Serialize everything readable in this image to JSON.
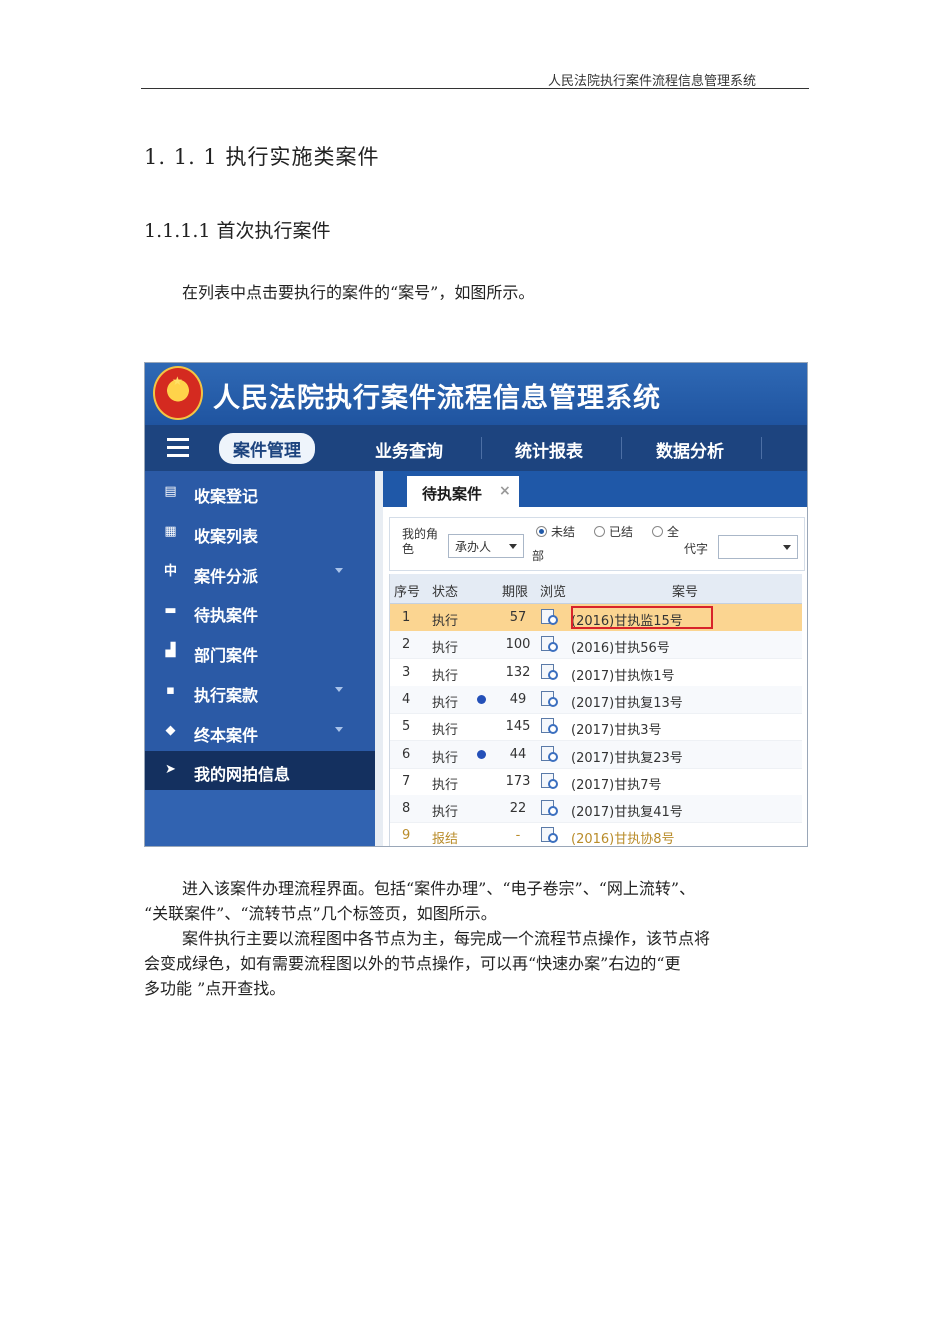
{
  "running_header": "人民法院执行案件流程信息管理系统",
  "heading_1": "1. 1. 1  执行实施类案件",
  "heading_2": "1.1.1.1 首次执行案件",
  "intro": "在列表中点击要执行的案件的“案号”，如图所示。",
  "body_lines": [
    "进入该案件办理流程界面。包括“案件办理”、“电子卷宗”、“网上流转”、",
    "“关联案件”、“流转节点”几个标签页，如图所示。",
    "案件执行主要以流程图中各节点为主，每完成一个流程节点操作，该节点将",
    "会变成绿色，如有需要流程图以外的节点操作，可以再“快速办案”右边的“更",
    "多功能  ”点开查找。"
  ],
  "app": {
    "title": "人民法院执行案件流程信息管理系统",
    "nav": [
      "案件管理",
      "业务查询",
      "统计报表",
      "数据分析"
    ],
    "sidebar": [
      {
        "label": "收案登记",
        "icon": "register-icon",
        "glyph": "▤",
        "arrow": false
      },
      {
        "label": "收案列表",
        "icon": "list-icon",
        "glyph": "▦",
        "arrow": false
      },
      {
        "label": "案件分派",
        "icon": "distribute-icon",
        "glyph": "中",
        "arrow": true
      },
      {
        "label": "待执案件",
        "icon": "briefcase-icon",
        "glyph": "▬",
        "arrow": false
      },
      {
        "label": "部门案件",
        "icon": "department-icon",
        "glyph": "▟",
        "arrow": false
      },
      {
        "label": "执行案款",
        "icon": "money-icon",
        "glyph": "▪",
        "arrow": true
      },
      {
        "label": "终本案件",
        "icon": "archive-icon",
        "glyph": "◆",
        "arrow": true
      },
      {
        "label": "我的网拍信息",
        "icon": "tag-icon",
        "glyph": "➤",
        "arrow": false
      }
    ],
    "tab": {
      "label": "待执案件",
      "close": "×"
    },
    "filter": {
      "role_label": "我的角色",
      "role_value": "承办人",
      "radios": [
        "未结",
        "已结",
        "全"
      ],
      "dept_label": "部",
      "code_label": "代字",
      "code_value": ""
    },
    "columns": [
      "序号",
      "状态",
      "期限",
      "浏览",
      "案号"
    ],
    "rows": [
      {
        "no": "1",
        "status": "执行",
        "dot": false,
        "limit": "57",
        "case": "(2016)甘执监15号"
      },
      {
        "no": "2",
        "status": "执行",
        "dot": false,
        "limit": "100",
        "case": "(2016)甘执56号"
      },
      {
        "no": "3",
        "status": "执行",
        "dot": false,
        "limit": "132",
        "case": "(2017)甘执恢1号"
      },
      {
        "no": "4",
        "status": "执行",
        "dot": true,
        "limit": "49",
        "case": "(2017)甘执复13号"
      },
      {
        "no": "5",
        "status": "执行",
        "dot": false,
        "limit": "145",
        "case": "(2017)甘执3号"
      },
      {
        "no": "6",
        "status": "执行",
        "dot": true,
        "limit": "44",
        "case": "(2017)甘执复23号"
      },
      {
        "no": "7",
        "status": "执行",
        "dot": false,
        "limit": "173",
        "case": "(2017)甘执7号"
      },
      {
        "no": "8",
        "status": "执行",
        "dot": false,
        "limit": "22",
        "case": "(2017)甘执复41号"
      },
      {
        "no": "9",
        "status": "报结",
        "dot": false,
        "limit": "-",
        "case": "(2016)甘执协8号"
      }
    ]
  }
}
